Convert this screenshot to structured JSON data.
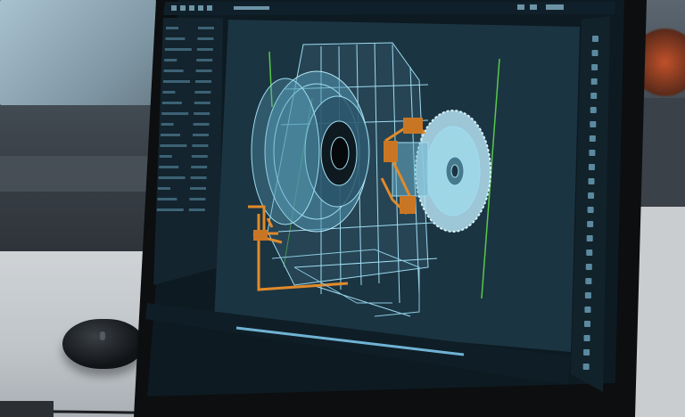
{
  "scene": {
    "description_type": "photo of a computer monitor displaying a CAD wireframe of a turbine/engine assembly",
    "colors": {
      "screen_bg": "#1b3442",
      "wireframe": "#9fdcf0",
      "accent_orange": "#e08a2a",
      "guide_green": "#59c84a",
      "panel_bg": "#16242d",
      "bezel": "#0c0e10"
    }
  },
  "app": {
    "toolbar_icons": [
      "folder-icon",
      "save-icon",
      "undo-icon",
      "redo-icon",
      "grid-icon",
      "view-icon",
      "settings-icon"
    ],
    "right_toolbar_icons": [
      "rotate-icon",
      "pan-icon",
      "zoom-icon",
      "measure-icon",
      "layer-icon",
      "section-icon",
      "render-icon",
      "snap-icon"
    ],
    "left_panel_rows": 18
  }
}
